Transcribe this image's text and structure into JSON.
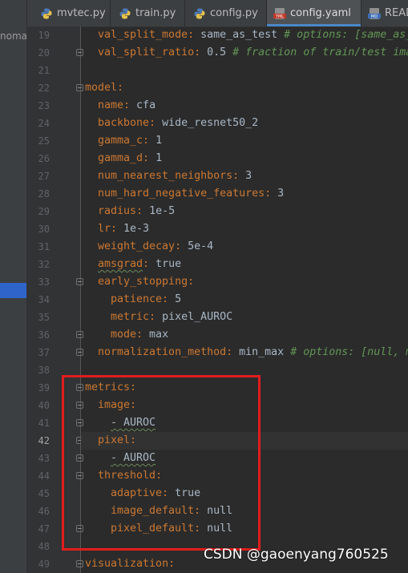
{
  "project": {
    "truncated_label": "nomal"
  },
  "tabs": [
    {
      "label": "mvtec.py",
      "type": "python",
      "active": false
    },
    {
      "label": "train.py",
      "type": "python",
      "active": false
    },
    {
      "label": "config.py",
      "type": "python",
      "active": false
    },
    {
      "label": "config.yaml",
      "type": "yaml",
      "active": true
    },
    {
      "label": "READ",
      "type": "markdown",
      "active": false
    }
  ],
  "editor": {
    "current_line": 42,
    "lines": [
      {
        "n": "19",
        "key": "val_split_mode",
        "val": " same_as_test ",
        "comment": "# options: [same_as_",
        "indent": 1
      },
      {
        "n": "20",
        "key": "val_split_ratio",
        "val": " 0.5 ",
        "comment": "# fraction of train/test ima",
        "indent": 1
      },
      {
        "n": "21",
        "key": "",
        "val": "",
        "comment": "",
        "indent": 0
      },
      {
        "n": "22",
        "key": "model",
        "val": "",
        "comment": "",
        "indent": 0
      },
      {
        "n": "23",
        "key": "name",
        "val": " cfa",
        "comment": "",
        "indent": 1
      },
      {
        "n": "24",
        "key": "backbone",
        "val": " wide_resnet50_2",
        "comment": "",
        "indent": 1
      },
      {
        "n": "25",
        "key": "gamma_c",
        "val": " 1",
        "comment": "",
        "indent": 1
      },
      {
        "n": "26",
        "key": "gamma_d",
        "val": " 1",
        "comment": "",
        "indent": 1
      },
      {
        "n": "27",
        "key": "num_nearest_neighbors",
        "val": " 3",
        "comment": "",
        "indent": 1
      },
      {
        "n": "28",
        "key": "num_hard_negative_features",
        "val": " 3",
        "comment": "",
        "indent": 1
      },
      {
        "n": "29",
        "key": "radius",
        "val": " 1e-5",
        "comment": "",
        "indent": 1
      },
      {
        "n": "30",
        "key": "lr",
        "val": " 1e-3",
        "comment": "",
        "indent": 1
      },
      {
        "n": "31",
        "key": "weight_decay",
        "val": " 5e-4",
        "comment": "",
        "indent": 1
      },
      {
        "n": "32",
        "key": "amsgrad",
        "val": " true",
        "comment": "",
        "indent": 1
      },
      {
        "n": "33",
        "key": "early_stopping",
        "val": "",
        "comment": "",
        "indent": 1
      },
      {
        "n": "34",
        "key": "patience",
        "val": " 5",
        "comment": "",
        "indent": 2
      },
      {
        "n": "35",
        "key": "metric",
        "val": " pixel_AUROC",
        "comment": "",
        "indent": 2
      },
      {
        "n": "36",
        "key": "mode",
        "val": " max",
        "comment": "",
        "indent": 2
      },
      {
        "n": "37",
        "key": "normalization_method",
        "val": " min_max ",
        "comment": "# options: [null, m",
        "indent": 1
      },
      {
        "n": "38",
        "key": "",
        "val": "",
        "comment": "",
        "indent": 0
      },
      {
        "n": "39",
        "key": "metrics",
        "val": "",
        "comment": "",
        "indent": 0
      },
      {
        "n": "40",
        "key": "image",
        "val": "",
        "comment": "",
        "indent": 1
      },
      {
        "n": "41",
        "key": "",
        "val": "- AUROC",
        "comment": "",
        "indent": 2
      },
      {
        "n": "42",
        "key": "pixel",
        "val": "",
        "comment": "",
        "indent": 1
      },
      {
        "n": "43",
        "key": "",
        "val": "- AUROC",
        "comment": "",
        "indent": 2
      },
      {
        "n": "44",
        "key": "threshold",
        "val": "",
        "comment": "",
        "indent": 1
      },
      {
        "n": "45",
        "key": "adaptive",
        "val": " true",
        "comment": "",
        "indent": 2
      },
      {
        "n": "46",
        "key": "image_default",
        "val": " null",
        "comment": "",
        "indent": 2
      },
      {
        "n": "47",
        "key": "pixel_default",
        "val": " null",
        "comment": "",
        "indent": 2
      },
      {
        "n": "48",
        "key": "",
        "val": "",
        "comment": "",
        "indent": 0
      },
      {
        "n": "49",
        "key": "visualization",
        "val": "",
        "comment": "",
        "indent": 0
      }
    ]
  },
  "watermark": "CSDN @gaoenyang760525",
  "colors": {
    "key": "#cc7832",
    "value": "#a9b7c6",
    "comment": "#629755",
    "highlight_box": "#e21d1d",
    "active_tab_underline": "#4a88c7"
  }
}
